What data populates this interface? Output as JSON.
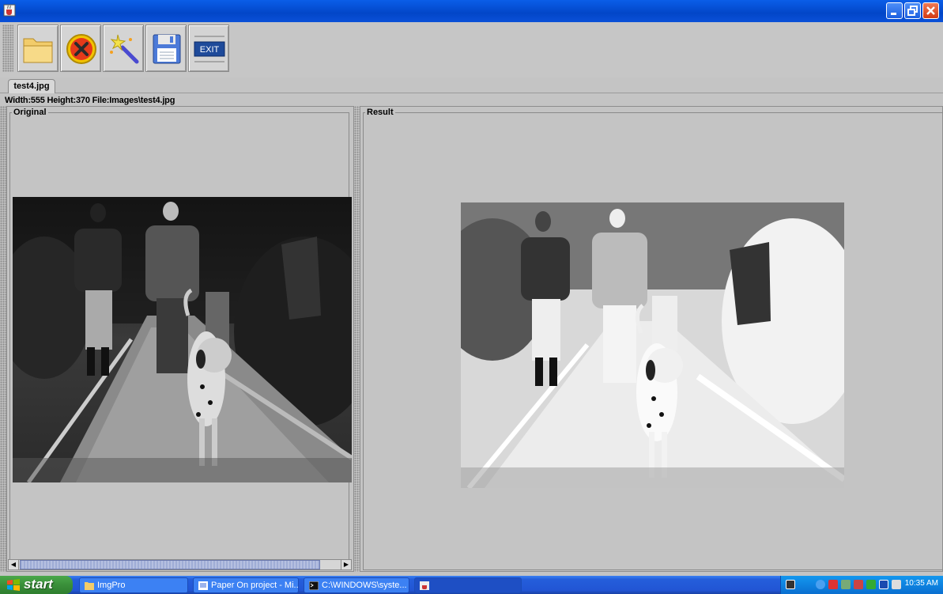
{
  "window": {
    "title": ""
  },
  "toolbar": {
    "buttons": [
      {
        "icon": "open-folder-icon"
      },
      {
        "icon": "close-x-icon"
      },
      {
        "icon": "magic-wand-icon"
      },
      {
        "icon": "floppy-save-icon"
      },
      {
        "icon": "exit-icon",
        "label": "EXIT"
      }
    ]
  },
  "tabs": [
    {
      "label": "test4.jpg"
    }
  ],
  "info": {
    "text": "Width:555  Height:370 File:Images\\test4.jpg"
  },
  "panels": {
    "original": {
      "label": "Original"
    },
    "result": {
      "label": "Result"
    }
  },
  "taskbar": {
    "start_label": "start",
    "tasks": [
      {
        "label": "ImgPro",
        "icon": "folder-icon"
      },
      {
        "label": "Paper On project - Mi...",
        "icon": "word-doc-icon"
      },
      {
        "label": "C:\\WINDOWS\\syste...",
        "icon": "cmd-icon"
      },
      {
        "label": "",
        "icon": "java-app-icon"
      }
    ],
    "clock": "10:35 AM"
  },
  "colors": {
    "titlebar": "#0a5ee8",
    "taskbar": "#245edb",
    "start": "#3a8f3a",
    "tray": "#0e83e0"
  }
}
